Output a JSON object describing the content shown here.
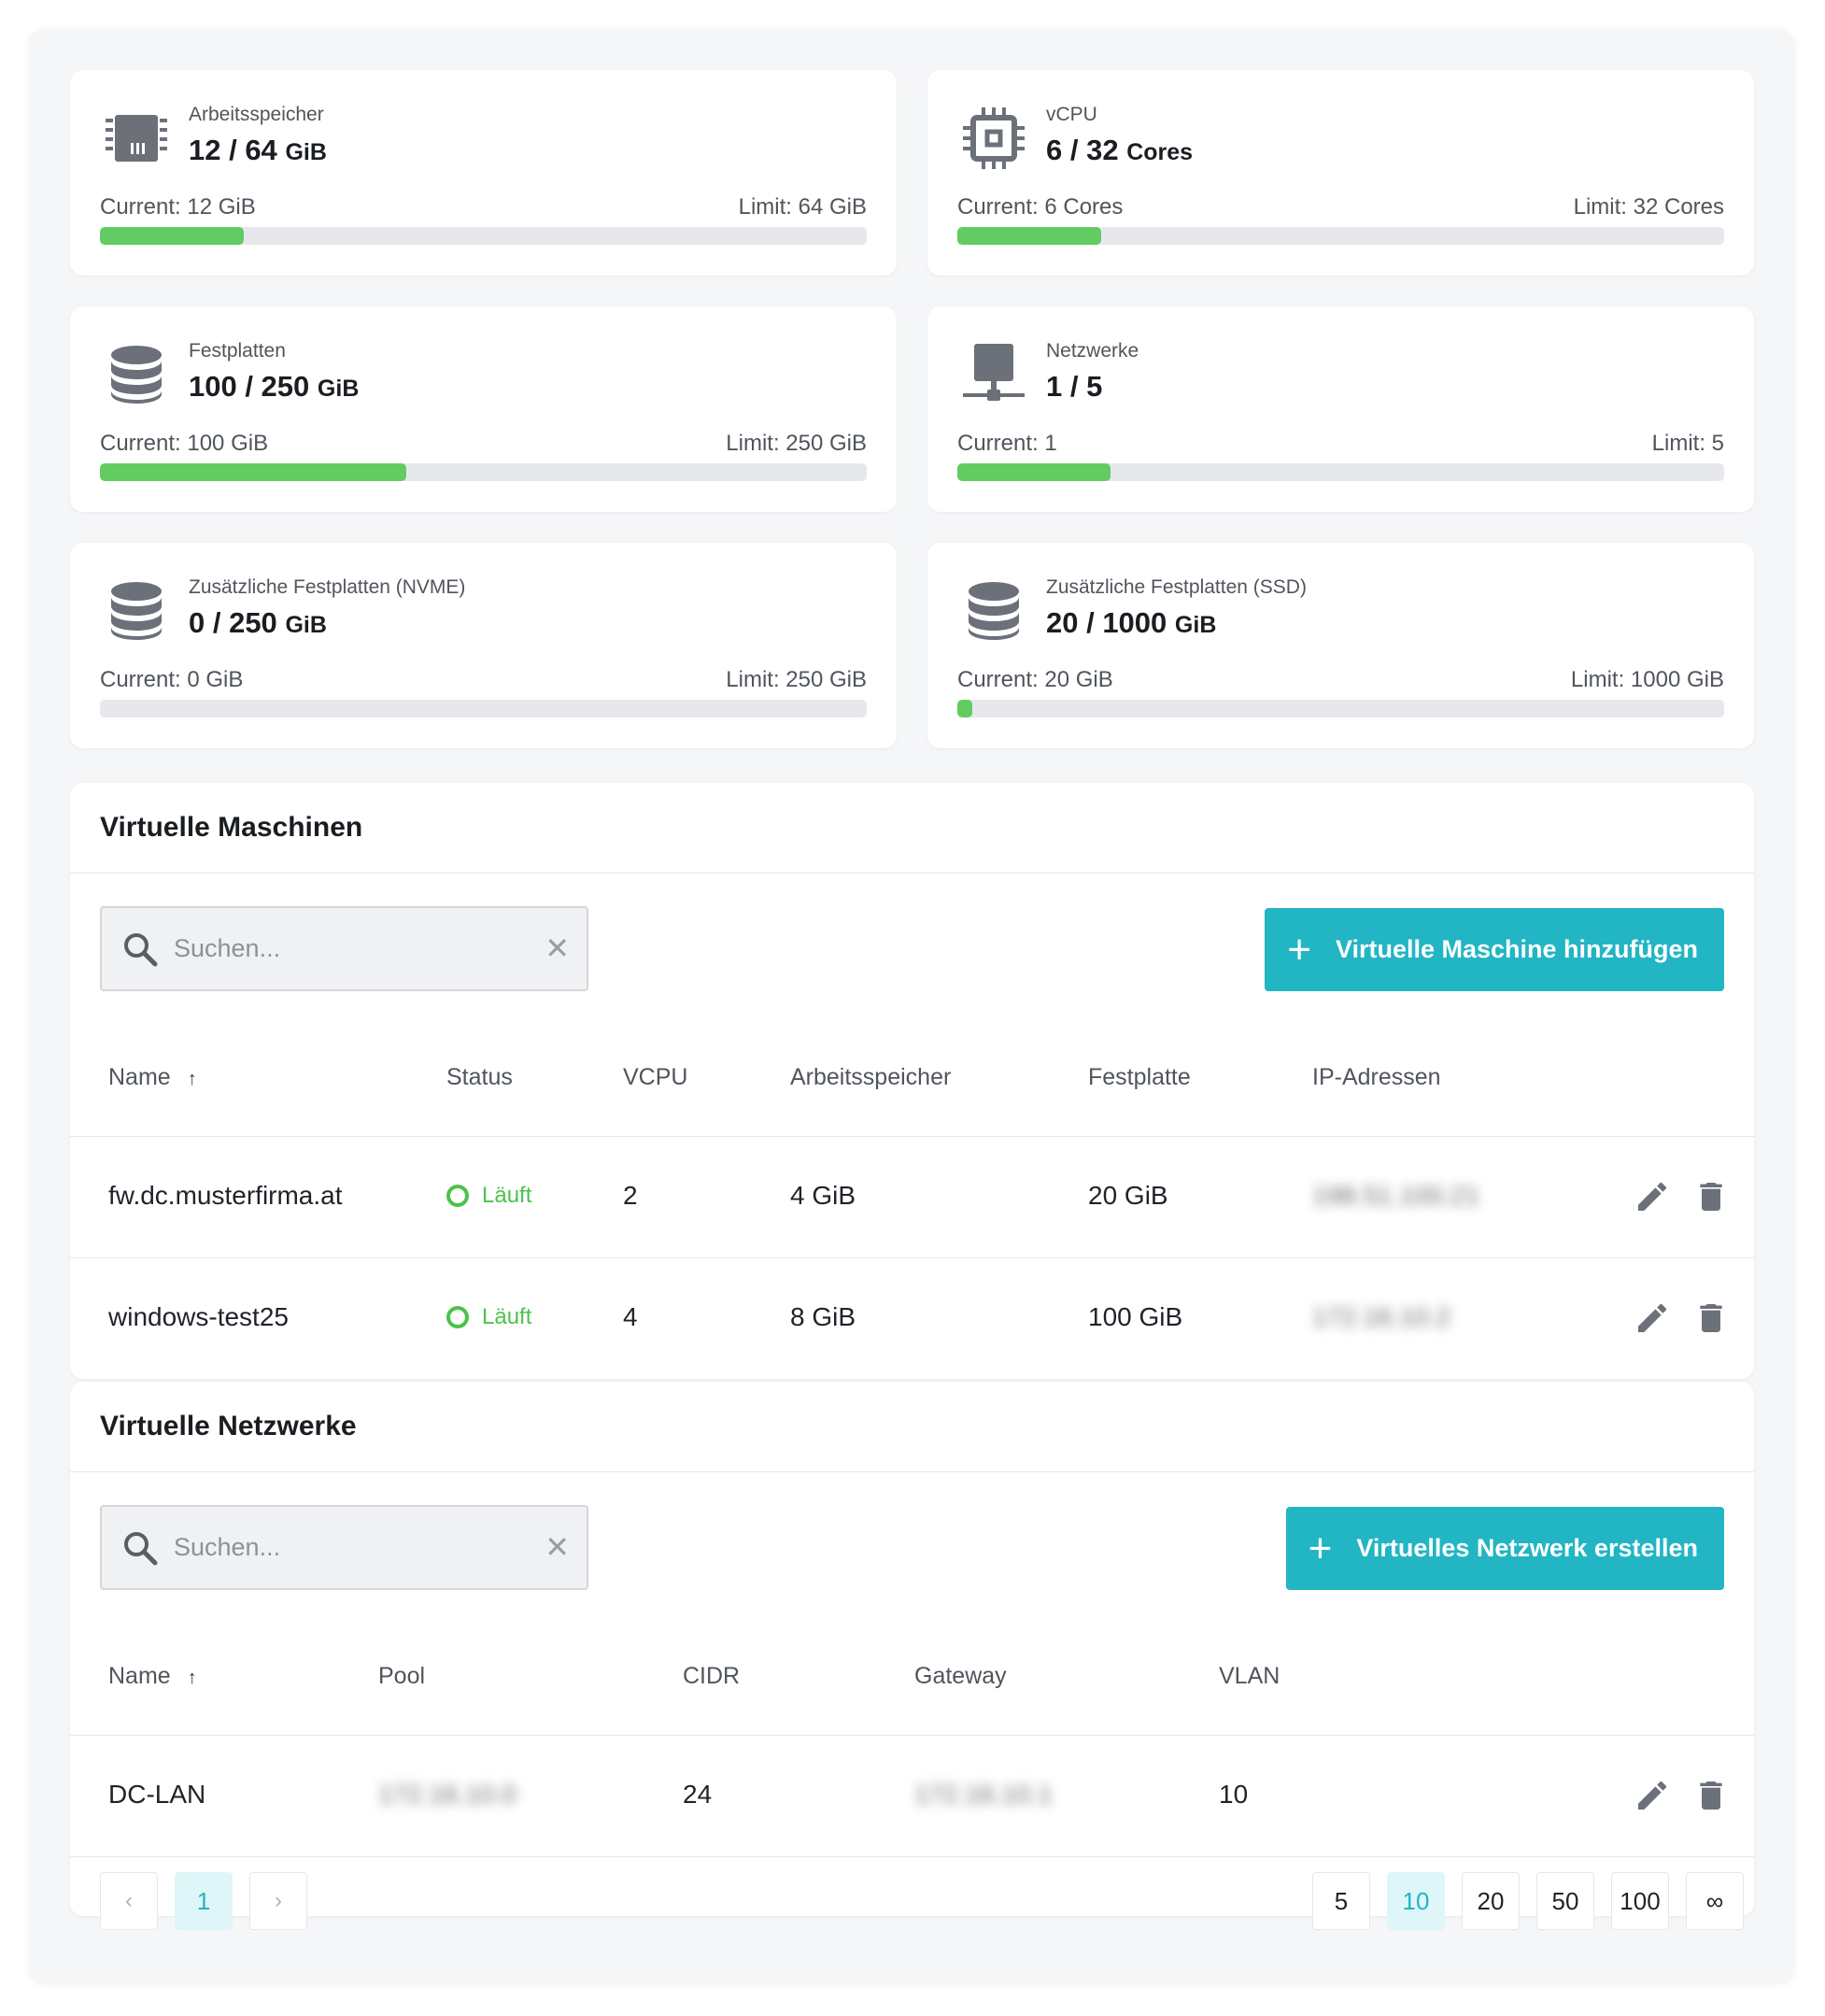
{
  "quotas": [
    {
      "label": "Arbeitsspeicher",
      "value": "12 / 64",
      "unit": "GiB",
      "current": "Current: 12 GiB",
      "limit": "Limit: 64 GiB",
      "fraction": 0.1875,
      "icon": "memory-icon"
    },
    {
      "label": "vCPU",
      "value": "6 / 32",
      "unit": "Cores",
      "current": "Current: 6 Cores",
      "limit": "Limit: 32 Cores",
      "fraction": 0.1875,
      "icon": "cpu-icon"
    },
    {
      "label": "Festplatten",
      "value": "100 / 250",
      "unit": "GiB",
      "current": "Current: 100 GiB",
      "limit": "Limit: 250 GiB",
      "fraction": 0.4,
      "icon": "database-icon"
    },
    {
      "label": "Netzwerke",
      "value": "1 / 5",
      "unit": "",
      "current": "Current: 1",
      "limit": "Limit: 5",
      "fraction": 0.2,
      "icon": "network-icon"
    },
    {
      "label": "Zusätzliche Festplatten (NVME)",
      "value": "0 / 250",
      "unit": "GiB",
      "current": "Current: 0 GiB",
      "limit": "Limit: 250 GiB",
      "fraction": 0,
      "icon": "database-icon"
    },
    {
      "label": "Zusätzliche Festplatten (SSD)",
      "value": "20 / 1000",
      "unit": "GiB",
      "current": "Current: 20 GiB",
      "limit": "Limit: 1000 GiB",
      "fraction": 0.02,
      "icon": "database-icon"
    }
  ],
  "vms": {
    "title": "Virtuelle Maschinen",
    "search_placeholder": "Suchen...",
    "add_label": "Virtuelle Maschine hinzufügen",
    "columns": {
      "name": "Name",
      "status": "Status",
      "vcpu": "VCPU",
      "ram": "Arbeitsspeicher",
      "disk": "Festplatte",
      "ip": "IP-Adressen"
    },
    "rows": [
      {
        "name": "fw.dc.musterfirma.at",
        "status": "Läuft",
        "vcpu": "2",
        "ram": "4 GiB",
        "disk": "20 GiB",
        "ip": "198.51.100.21"
      },
      {
        "name": "windows-test25",
        "status": "Läuft",
        "vcpu": "4",
        "ram": "8 GiB",
        "disk": "100 GiB",
        "ip": "172.16.10.2"
      }
    ]
  },
  "networks": {
    "title": "Virtuelle Netzwerke",
    "search_placeholder": "Suchen...",
    "add_label": "Virtuelles Netzwerk erstellen",
    "columns": {
      "name": "Name",
      "pool": "Pool",
      "cidr": "CIDR",
      "gateway": "Gateway",
      "vlan": "VLAN"
    },
    "rows": [
      {
        "name": "DC-LAN",
        "pool": "172.16.10.0",
        "cidr": "24",
        "gateway": "172.16.10.1",
        "vlan": "10"
      }
    ]
  },
  "pagination": {
    "prev": "‹",
    "next": "›",
    "current_page": "1",
    "page_sizes": [
      "5",
      "10",
      "20",
      "50",
      "100",
      "∞"
    ],
    "active_size": "10"
  },
  "colors": {
    "accent": "#22b5c4",
    "progress": "#62cc62",
    "running": "#4cc24c"
  }
}
